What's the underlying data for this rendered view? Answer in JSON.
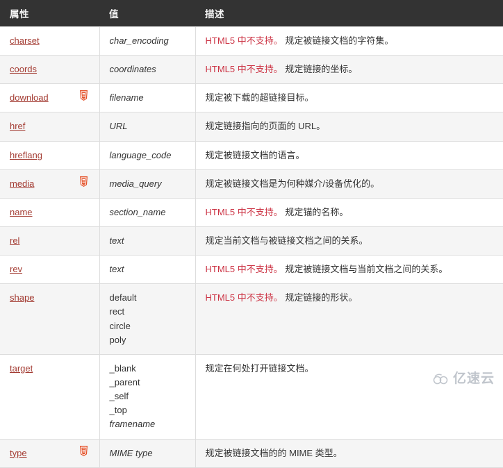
{
  "table": {
    "headers": {
      "attribute": "属性",
      "value": "值",
      "description": "描述"
    },
    "html5_badge_label": "HTML5",
    "rows": [
      {
        "attribute": "charset",
        "html5": false,
        "value": "char_encoding",
        "value_style": "italic",
        "warn": "HTML5 中不支持。",
        "description": "规定被链接文档的字符集。"
      },
      {
        "attribute": "coords",
        "html5": false,
        "value": "coordinates",
        "value_style": "italic",
        "warn": "HTML5 中不支持。",
        "description": "规定链接的坐标。"
      },
      {
        "attribute": "download",
        "html5": true,
        "value": "filename",
        "value_style": "italic",
        "warn": "",
        "description": "规定被下载的超链接目标。"
      },
      {
        "attribute": "href",
        "html5": false,
        "value": "URL",
        "value_style": "italic",
        "warn": "",
        "description": "规定链接指向的页面的 URL。"
      },
      {
        "attribute": "hreflang",
        "html5": false,
        "value": "language_code",
        "value_style": "italic",
        "warn": "",
        "description": "规定被链接文档的语言。"
      },
      {
        "attribute": "media",
        "html5": true,
        "value": "media_query",
        "value_style": "italic",
        "warn": "",
        "description": "规定被链接文档是为何种媒介/设备优化的。"
      },
      {
        "attribute": "name",
        "html5": false,
        "value": "section_name",
        "value_style": "italic",
        "warn": "HTML5 中不支持。",
        "description": "规定锚的名称。"
      },
      {
        "attribute": "rel",
        "html5": false,
        "value": "text",
        "value_style": "italic",
        "warn": "",
        "description": "规定当前文档与被链接文档之间的关系。"
      },
      {
        "attribute": "rev",
        "html5": false,
        "value": "text",
        "value_style": "italic",
        "warn": "HTML5 中不支持。",
        "description": "规定被链接文档与当前文档之间的关系。"
      },
      {
        "attribute": "shape",
        "html5": false,
        "value_list": [
          {
            "text": "default",
            "style": "plain"
          },
          {
            "text": "rect",
            "style": "plain"
          },
          {
            "text": "circle",
            "style": "plain"
          },
          {
            "text": "poly",
            "style": "plain"
          }
        ],
        "warn": "HTML5 中不支持。",
        "description": "规定链接的形状。"
      },
      {
        "attribute": "target",
        "html5": false,
        "value_list": [
          {
            "text": "_blank",
            "style": "plain"
          },
          {
            "text": "_parent",
            "style": "plain"
          },
          {
            "text": "_self",
            "style": "plain"
          },
          {
            "text": "_top",
            "style": "plain"
          },
          {
            "text": "framename",
            "style": "italic"
          }
        ],
        "warn": "",
        "description": "规定在何处打开链接文档。"
      },
      {
        "attribute": "type",
        "html5": true,
        "value": "MIME type",
        "value_style": "italic",
        "warn": "",
        "description": "规定被链接文档的的 MIME 类型。"
      }
    ]
  },
  "watermark": {
    "text": "亿速云"
  },
  "colors": {
    "header_background": "#333333",
    "header_text": "#f5f5f5",
    "link": "#a33b32",
    "warning": "#cc3344",
    "body_text": "#333333",
    "stripe": "#f5f5f5",
    "border": "#dddddd",
    "badge": "#e34f26",
    "watermark": "#9aa3ad"
  }
}
